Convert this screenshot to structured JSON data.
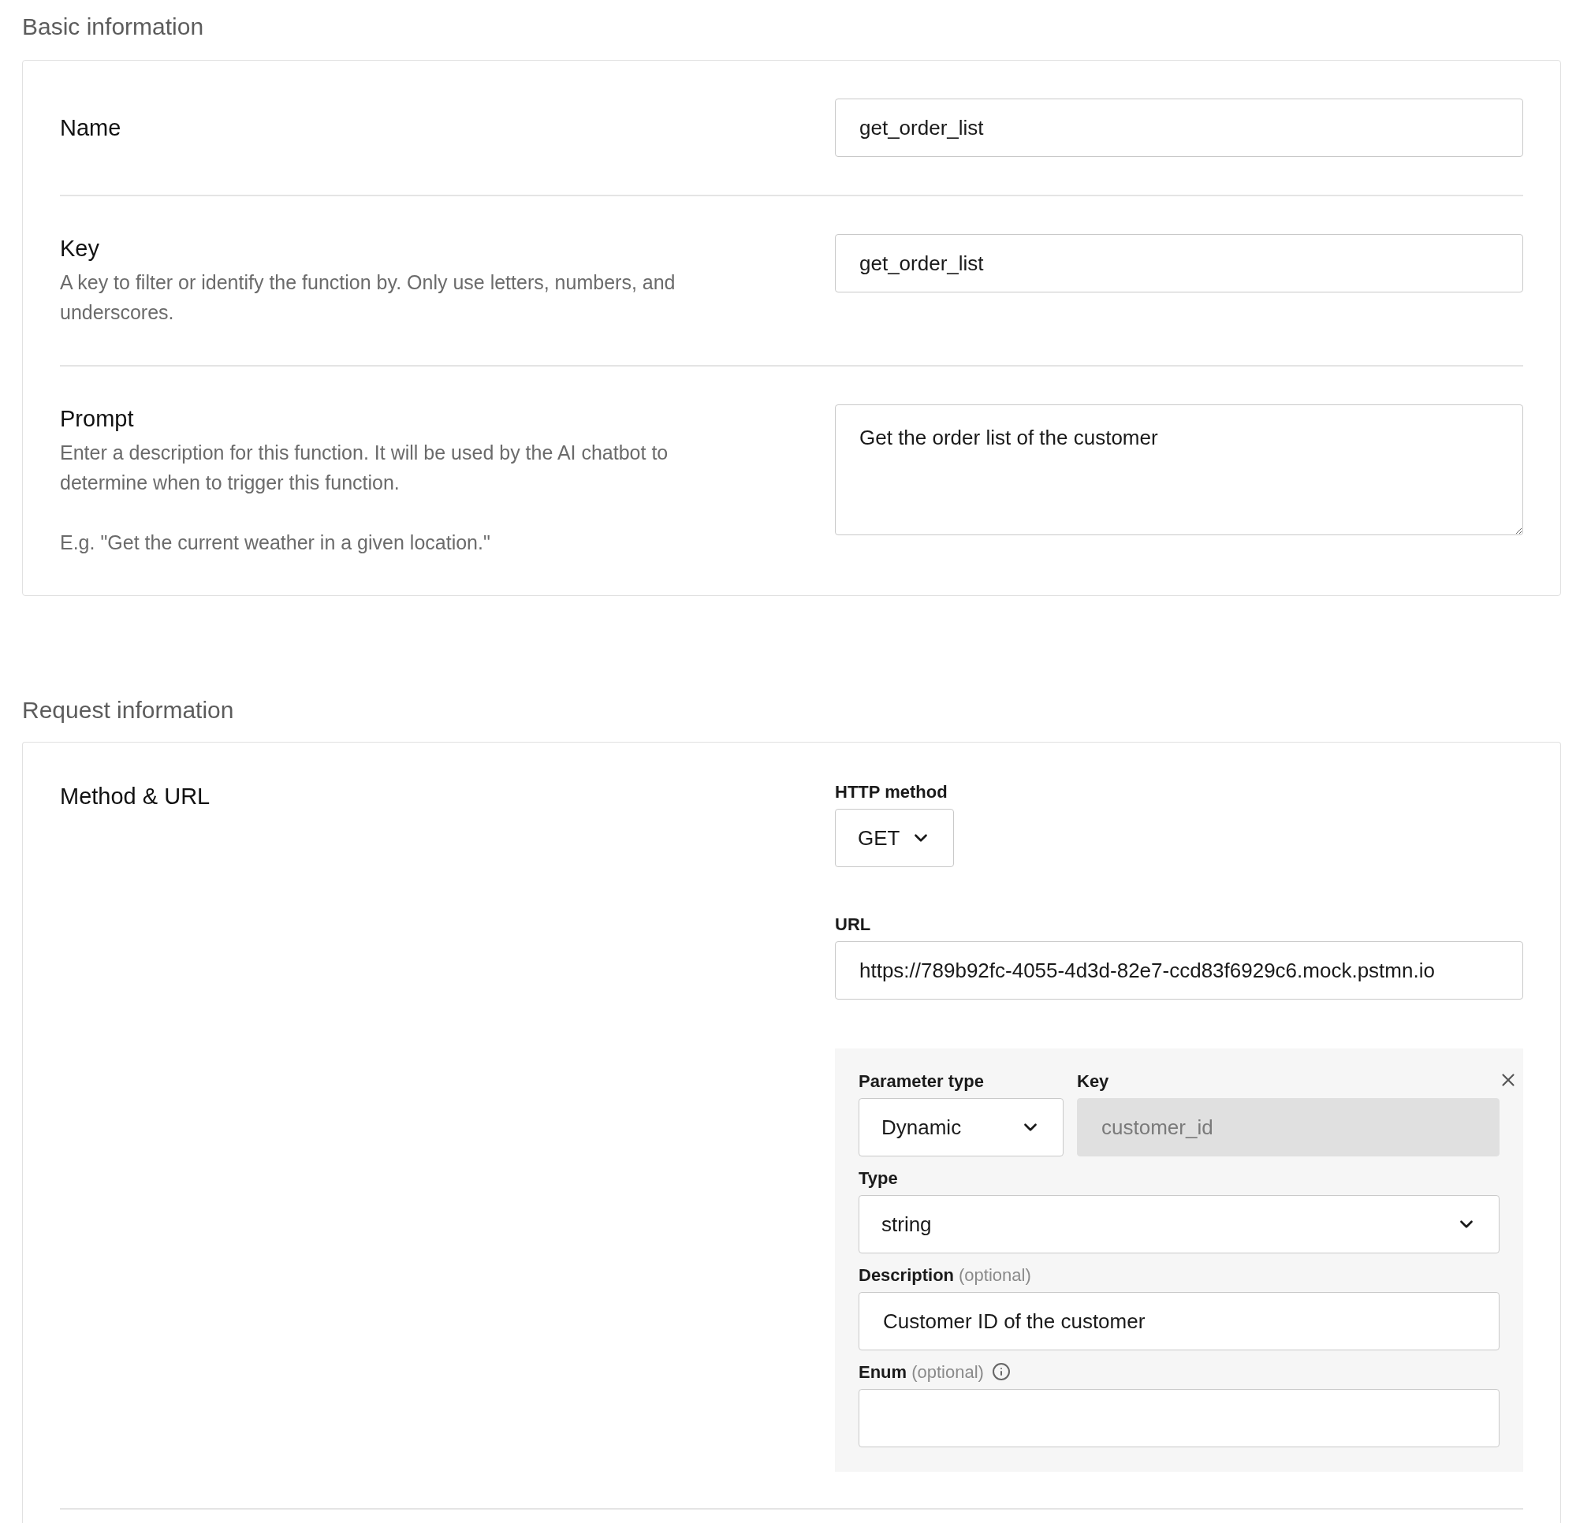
{
  "basic_information": {
    "title": "Basic information",
    "fields": [
      {
        "kind": "text",
        "label": "Name",
        "value": "get_order_list"
      },
      {
        "kind": "text",
        "label": "Key",
        "help": [
          "A key to filter or identify the function by. Only use letters, numbers, and underscores."
        ],
        "value": "get_order_list"
      },
      {
        "kind": "textarea",
        "label": "Prompt",
        "help": [
          "Enter a description for this function. It will be used by the AI chatbot to determine when to trigger this function.",
          "E.g. \"Get the current weather in a given location.\""
        ],
        "value": "Get the order list of the customer"
      }
    ]
  },
  "request_information": {
    "title": "Request information",
    "method_url": {
      "label": "Method & URL",
      "http_method": {
        "label": "HTTP method",
        "value": "GET"
      },
      "url": {
        "label": "URL",
        "value": "https://789b92fc-4055-4d3d-82e7-ccd83f6929c6.mock.pstmn.io"
      },
      "parameter": {
        "parameter_type": {
          "label": "Parameter type",
          "value": "Dynamic"
        },
        "key": {
          "label": "Key",
          "value": "customer_id",
          "disabled": true
        },
        "type": {
          "label": "Type",
          "value": "string"
        },
        "description": {
          "label": "Description",
          "optional": "(optional)",
          "value": "Customer ID of the customer"
        },
        "enum": {
          "label": "Enum",
          "optional": "(optional)"
        }
      }
    }
  }
}
